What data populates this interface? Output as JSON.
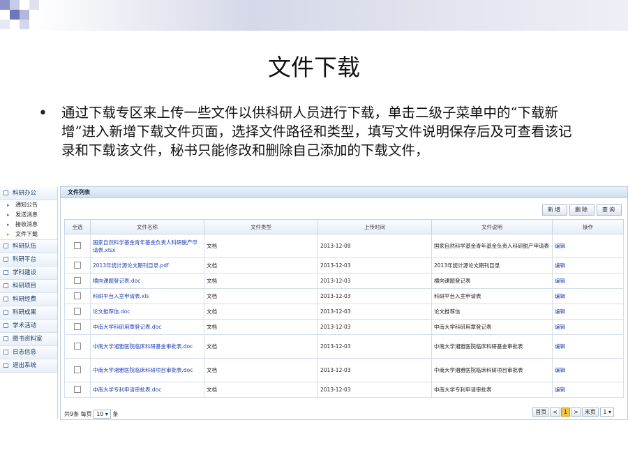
{
  "slide": {
    "title": "文件下载",
    "bullet": "•",
    "paragraph": "通过下载专区来上传一些文件以供科研人员进行下载，单击二级子菜单中的“下载新增”进入新增下载文件页面，选择文件路径和类型，填写文件说明保存后及可查看该记录和下载该文件，秘书只能修改和删除自己添加的下载文件，"
  },
  "sidebar": {
    "group1": "科研办公",
    "subitems": [
      "通知公告",
      "发送消息",
      "接收消息",
      "文件下载"
    ],
    "items": [
      "科研队伍",
      "科研平台",
      "学科建设",
      "科研项目",
      "科研经费",
      "科研成果",
      "学术活动",
      "图书资料室",
      "日志信息",
      "退出系统"
    ]
  },
  "panel": {
    "title": "文件列表",
    "buttons": {
      "add": "新增",
      "delete": "删除",
      "query": "查询"
    },
    "columns": [
      "全选",
      "文件名称",
      "文件类型",
      "上传时间",
      "文件说明",
      "操作"
    ],
    "rows": [
      {
        "name": "国家自然科学基金青年基金负责人科研脱产申请表.xlsx",
        "type": "文档",
        "time": "2013-12-09",
        "desc": "国家自然科学基金青年基金负责人科研脱产申请表",
        "op": "编辑"
      },
      {
        "name": "2013年统计源论文期刊目录.pdf",
        "type": "文档",
        "time": "2013-12-03",
        "desc": "2013年统计源论文期刊目录",
        "op": "编辑"
      },
      {
        "name": "横向课题登记表.doc",
        "type": "文档",
        "time": "2013-12-03",
        "desc": "横向课题登记表",
        "op": "编辑"
      },
      {
        "name": "科研平台入室申请表.xls",
        "type": "文档",
        "time": "2013-12-03",
        "desc": "科研平台入室申请表",
        "op": "编辑"
      },
      {
        "name": "论文推荐信.doc",
        "type": "文档",
        "time": "2013-12-03",
        "desc": "论文推荐信",
        "op": "编辑"
      },
      {
        "name": "中南大学科研用章登记表.doc",
        "type": "文档",
        "time": "2013-12-03",
        "desc": "中南大学科研用章登记表",
        "op": "编辑"
      },
      {
        "name": "中南大学湘雅医院临床科研基金审批表.doc",
        "type": "文档",
        "time": "2013-12-03",
        "desc": "中南大学湘雅医院临床科研基金审批表",
        "op": "编辑"
      },
      {
        "name": "中南大学湘雅医院临床科研项目审批表.doc",
        "type": "文档",
        "time": "2013-12-03",
        "desc": "中南大学湘雅医院临床科研项目审批表",
        "op": "编辑"
      },
      {
        "name": "中南大学专利申请审批表.doc",
        "type": "文档",
        "time": "2013-12-03",
        "desc": "中南大学专利申请审批表",
        "op": "编辑"
      }
    ],
    "footer": {
      "total": "共9条",
      "per_page_label": "每页",
      "per_page_value": "10",
      "unit": "条",
      "first": "首页",
      "prev": "<",
      "current": "1",
      "next": ">",
      "last": "末页",
      "jump_value": "1"
    }
  },
  "colors": {
    "link": "#1c3fb5",
    "current_page": "#f5c542",
    "header_bg": "#cfdff0"
  }
}
